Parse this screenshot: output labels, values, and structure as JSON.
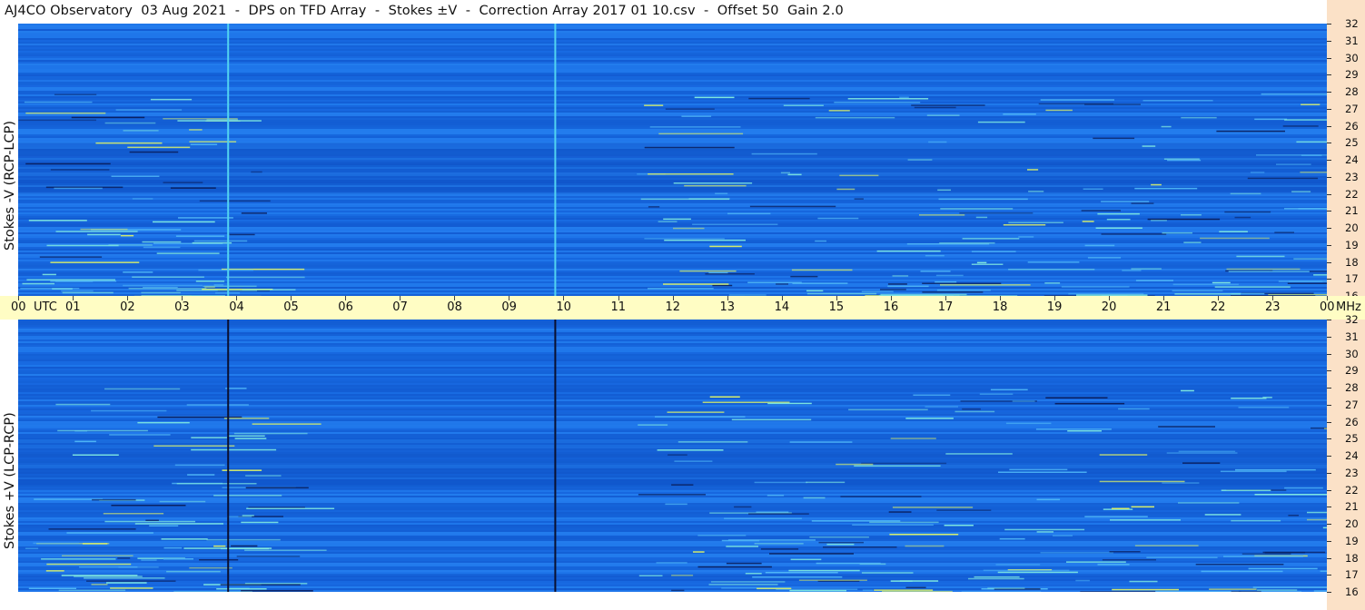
{
  "window": {
    "title": "AJ4CO Observatory  03 Aug 2021  -  DPS on TFD Array  -  Stokes ±V  -  Correction Array 2017 01 10.csv  -  Offset 50  Gain 2.0"
  },
  "colors": {
    "background_blue": "#1a6fe6",
    "time_bar": "#fffdc4",
    "freq_scale": "#fbe1c7",
    "marker_top": "#52d3f0",
    "marker_bottom": "#0a1030"
  },
  "chart_data": [
    {
      "type": "heatmap",
      "title": "AJ4CO Observatory  03 Aug 2021  -  DPS on TFD Array  -  Stokes ±V  -  Correction Array 2017 01 10.csv  -  Offset 50  Gain 2.0",
      "ylabel": "Stokes -V (RCP-LCP)",
      "x_unit": "UTC",
      "y_unit": "MHz",
      "xlim": [
        0,
        24
      ],
      "ylim": [
        16,
        32
      ],
      "x_ticks": [
        "00",
        "01",
        "02",
        "03",
        "04",
        "05",
        "06",
        "07",
        "08",
        "09",
        "10",
        "11",
        "12",
        "13",
        "14",
        "15",
        "16",
        "17",
        "18",
        "19",
        "20",
        "21",
        "22",
        "23",
        "00"
      ],
      "y_ticks": [
        16,
        17,
        18,
        19,
        20,
        21,
        22,
        23,
        24,
        25,
        26,
        27,
        28,
        29,
        30,
        31,
        32
      ],
      "vertical_markers_utc": [
        3.85,
        9.85
      ]
    },
    {
      "type": "heatmap",
      "ylabel": "Stokes +V (LCP-RCP)",
      "x_unit": "UTC",
      "y_unit": "MHz",
      "xlim": [
        0,
        24
      ],
      "ylim": [
        16,
        32
      ],
      "x_ticks": [
        "00",
        "01",
        "02",
        "03",
        "04",
        "05",
        "06",
        "07",
        "08",
        "09",
        "10",
        "11",
        "12",
        "13",
        "14",
        "15",
        "16",
        "17",
        "18",
        "19",
        "20",
        "21",
        "22",
        "23",
        "00"
      ],
      "y_ticks": [
        16,
        17,
        18,
        19,
        20,
        21,
        22,
        23,
        24,
        25,
        26,
        27,
        28,
        29,
        30,
        31,
        32
      ],
      "vertical_markers_utc": [
        3.85,
        9.85
      ]
    }
  ],
  "axis": {
    "time_unit": "UTC",
    "freq_unit": "MHz"
  }
}
